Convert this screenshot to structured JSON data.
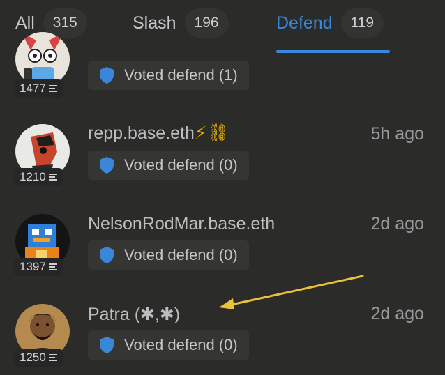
{
  "tabs": [
    {
      "label": "All",
      "count": "315"
    },
    {
      "label": "Slash",
      "count": "196"
    },
    {
      "label": "Defend",
      "count": "119"
    }
  ],
  "accent_color": "#3a86d8",
  "rows": [
    {
      "username": "",
      "timestamp": "",
      "score": "1477",
      "vote": "Voted defend (1)"
    },
    {
      "username": "repp.base.eth",
      "suffix": "⚡⛓",
      "timestamp": "5h ago",
      "score": "1210",
      "vote": "Voted defend (0)"
    },
    {
      "username": "NelsonRodMar.base.eth",
      "timestamp": "2d ago",
      "score": "1397",
      "vote": "Voted defend (0)"
    },
    {
      "username": "Patra (✱,✱)",
      "timestamp": "2d ago",
      "score": "1250",
      "vote": "Voted defend (0)"
    }
  ],
  "icons": {
    "shield": "shield-icon",
    "score": "bars-icon"
  },
  "annotation": {
    "type": "arrow",
    "color": "#e9c23a"
  }
}
